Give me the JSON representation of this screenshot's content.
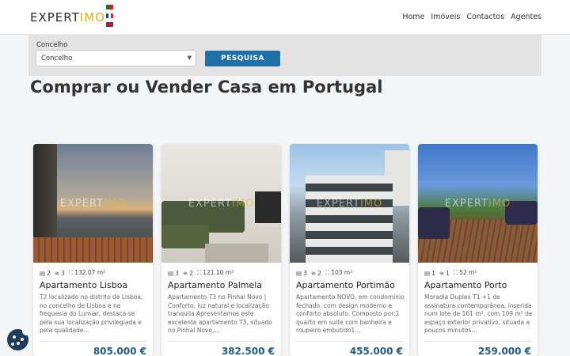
{
  "header": {
    "logo": {
      "main": "EXPERT",
      "accent": "IMO"
    },
    "languages": [
      "pt",
      "fr",
      "gb"
    ],
    "nav": [
      "Home",
      "Imóveis",
      "Contactos",
      "Agentes"
    ]
  },
  "search": {
    "label": "Concelho",
    "select_value": "Concelho",
    "button": "PESQUISA"
  },
  "page_title": "Comprar ou Vender Casa em Portugal",
  "watermark": {
    "main": "EXPERT",
    "accent": "IMO"
  },
  "listings": [
    {
      "beds": "2",
      "baths": "3",
      "area": "132.07 m²",
      "title": "Apartamento Lisboa",
      "description": "T2 localizado no distrito de Lisboa, no concelho de Lisboa e na freguesia do Lumiar, destaca-se pela sua localização privilegiada e pela qualidade...",
      "price": "805.000 €"
    },
    {
      "beds": "3",
      "baths": "2",
      "area": "121.10 m²",
      "title": "Apartamento Palmela",
      "description": "Apartamento T3 no Pinhal Novo | Conforto, luz natural e localização tranquila Apresentamos este excelente apartamento T3, situado no Pinhal Novo,...",
      "price": "382.500 €"
    },
    {
      "beds": "3",
      "baths": "2",
      "area": "103 m²",
      "title": "Apartamento Portimão",
      "description": "Apartamento NOVO, em condomínio fechado, com design moderno e conforto absoluto. Composto por:1 quarto em suite com banheira e roupeiro embutido1...",
      "price": "455.000 €"
    },
    {
      "beds": "1",
      "baths": "1",
      "area": "52 m²",
      "title": "Apartamento Porto",
      "description": "Moradia Duplex T1 +1 de assinatura contemporânea, inserida num lote de 161 m², com 109 m² de espaço exterior privativo, situada a poucos minutos...",
      "price": "259.000 €"
    }
  ],
  "colors": {
    "accent": "#e0b020",
    "button": "#1f6fa8",
    "price": "#1f5b88"
  }
}
